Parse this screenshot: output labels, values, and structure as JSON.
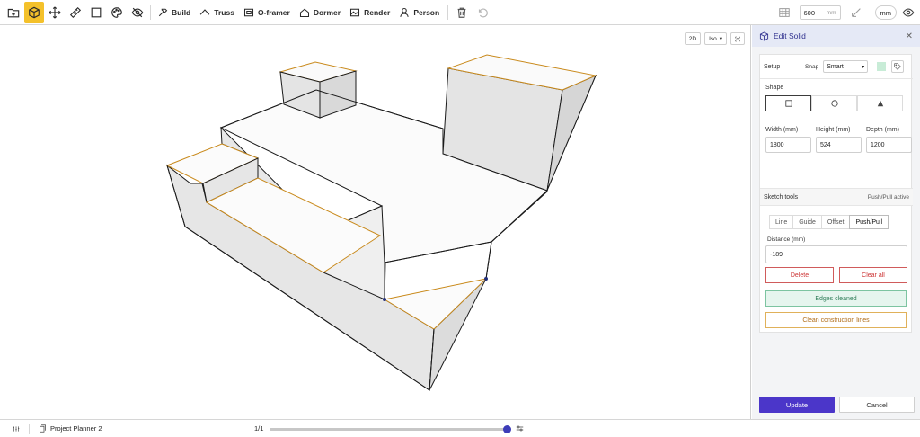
{
  "toolbar": {
    "items": [
      {
        "name": "folder-icon"
      },
      {
        "name": "cube-icon",
        "active": true
      },
      {
        "name": "move-icon"
      },
      {
        "name": "ruler-icon"
      },
      {
        "name": "square-icon"
      },
      {
        "name": "palette-icon"
      },
      {
        "name": "eye-off-icon"
      }
    ],
    "build_label": "Build",
    "truss_label": "Truss",
    "oframer_label": "O-framer",
    "dormer_label": "Dormer",
    "render_label": "Render",
    "person_label": "Person",
    "grid_value": "600",
    "grid_unit": "mm",
    "units_label": "mm",
    "accent_color": "#f4c12b"
  },
  "viewport": {
    "view_2d_label": "2D",
    "view_iso_label": "Iso"
  },
  "panel": {
    "title": "Edit Solid",
    "setup_label": "Setup",
    "snap_label": "Snap",
    "snap_value": "Smart",
    "shape_label": "Shape",
    "width_label": "Width (mm)",
    "width_value": "1800",
    "height_label": "Height (mm)",
    "height_value": "524",
    "depth_label": "Depth (mm)",
    "depth_value": "1200",
    "sketch_tools_label": "Sketch tools",
    "sketch_status": "Push/Pull active",
    "tabs": [
      "Line",
      "Guide",
      "Offset",
      "Push/Pull"
    ],
    "active_tab": "Push/Pull",
    "distance_label": "Distance (mm)",
    "distance_value": "-189",
    "delete_label": "Delete",
    "clear_all_label": "Clear all",
    "edges_cleaned_label": "Edges cleaned",
    "clean_construction_label": "Clean construction lines",
    "update_label": "Update",
    "cancel_label": "Cancel",
    "primary_color": "#4b36c9"
  },
  "bottombar": {
    "project_name": "Project Planner 2",
    "page_counter": "1/1",
    "slider_fraction": 1.0
  }
}
